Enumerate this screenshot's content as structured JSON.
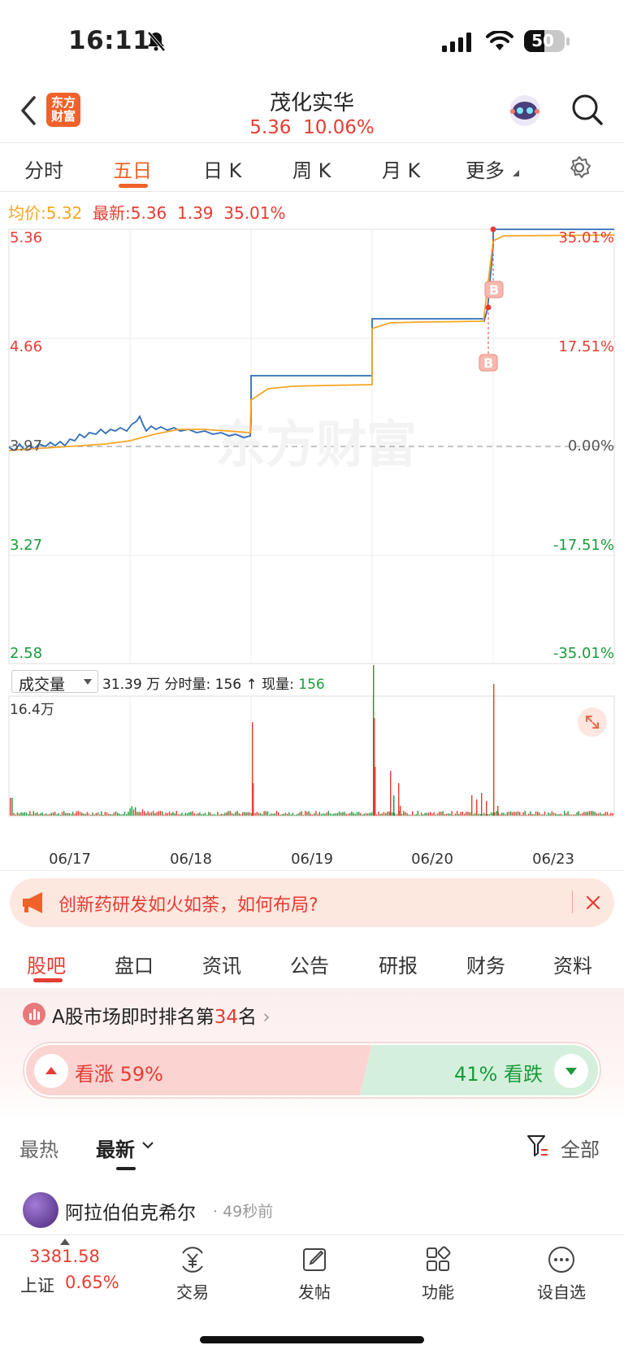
{
  "status": {
    "time": "16:11",
    "battery": "50"
  },
  "header": {
    "title": "茂化实华",
    "price": "5.36",
    "change_pct": "10.06%",
    "logo_line1": "东方",
    "logo_line2": "财富"
  },
  "tabs": [
    "分时",
    "五日",
    "日 K",
    "周 K",
    "月 K",
    "更多"
  ],
  "active_tab": "五日",
  "info": {
    "avg_label": "均价:",
    "avg_value": "5.32",
    "latest_label": "最新:",
    "latest_value": "5.36",
    "change": "1.39",
    "pct": "35.01%"
  },
  "chart": {
    "left_labels": [
      "5.36",
      "4.66",
      "3.97",
      "3.27",
      "2.58"
    ],
    "right_labels": [
      "35.01%",
      "17.51%",
      "0.00%",
      "-17.51%",
      "-35.01%"
    ],
    "watermark": "东方财富",
    "markers": [
      "B",
      "B"
    ],
    "dates": [
      "06/17",
      "06/18",
      "06/19",
      "06/20",
      "06/23"
    ],
    "colors": {
      "price": "#2f6db8",
      "avg": "#f5a623",
      "up": "#e63c31",
      "down": "#1a9a3a"
    }
  },
  "chart_data": {
    "type": "line",
    "x": [
      "06/17",
      "06/18",
      "06/19",
      "06/20",
      "06/23"
    ],
    "ylim": [
      2.58,
      5.36
    ],
    "series": [],
    "volume_max": "16.4万"
  },
  "volume": {
    "selector": "成交量",
    "total": "31.39 万",
    "fen_label": "分时量:",
    "fen_value": "156",
    "now_label": "现量:",
    "now_value": "156",
    "max_label": "16.4万"
  },
  "banner": {
    "text": "创新药研发如火如荼，如何布局?"
  },
  "nav_tabs": [
    "股吧",
    "盘口",
    "资讯",
    "公告",
    "研报",
    "财务",
    "资料"
  ],
  "active_nav": "股吧",
  "rank": {
    "prefix": "A股市场即时排名第",
    "num": "34",
    "suffix": "名"
  },
  "sentiment": {
    "up_label": "看涨 59%",
    "down_label": "41% 看跌",
    "up_fraction": 0.59
  },
  "filter": {
    "hot": "最热",
    "latest": "最新",
    "all": "全部"
  },
  "post": {
    "user": "阿拉伯伯克希尔",
    "time": "· 49秒前"
  },
  "bottom": {
    "index_value": "3381.58",
    "index_name": "上证",
    "index_pct": "0.65%",
    "items": [
      "交易",
      "发帖",
      "功能",
      "设自选"
    ]
  }
}
